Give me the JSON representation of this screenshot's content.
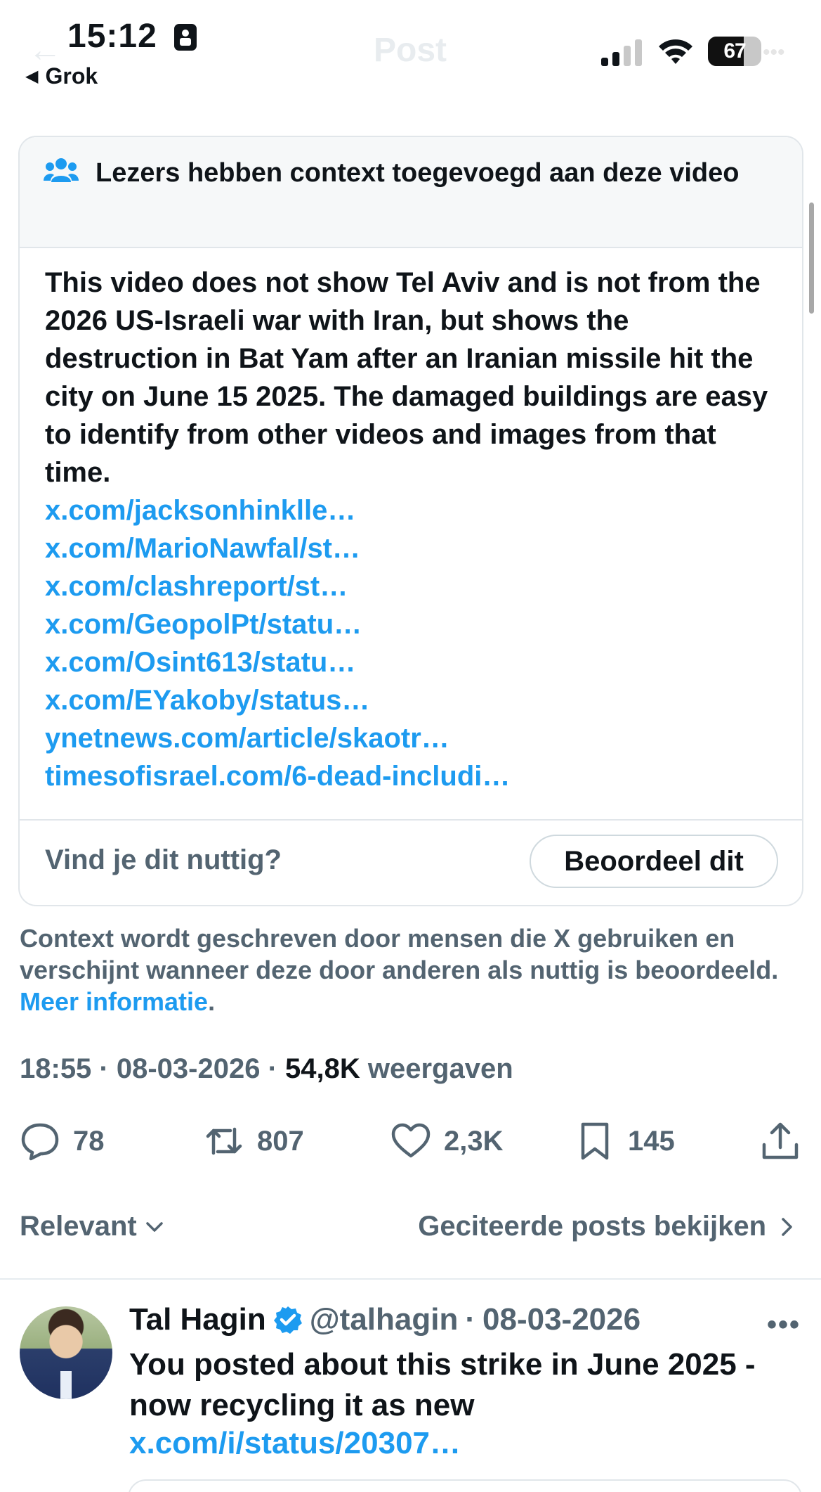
{
  "status_bar": {
    "time": "15:12",
    "back_app": "Grok",
    "battery": "67",
    "battery_level": 0.67
  },
  "header": {
    "title": "Post",
    "back_icon": "arrow-left-icon"
  },
  "note": {
    "title": "Lezers hebben context toegevoegd aan deze video",
    "body": "This video does not show Tel Aviv and is not from the 2026 US-Israeli war with Iran, but shows the destruction in Bat Yam after an Iranian missile hit the city on June 15 2025. The damaged buildings are easy to identify from other videos and images from that time.",
    "links": [
      "x.com/jacksonhinklle…",
      "x.com/MarioNawfal/st…",
      "x.com/clashreport/st…",
      "x.com/GeopolPt/statu…",
      "x.com/Osint613/statu…",
      "x.com/EYakoby/status…",
      "ynetnews.com/article/skaotr…",
      "timesofisrael.com/6-dead-includi…"
    ],
    "helpful_question": "Vind je dit nuttig?",
    "rate_button": "Beoordeel dit"
  },
  "context_info": {
    "text": "Context wordt geschreven door mensen die X gebruiken en verschijnt wanneer deze door anderen als nuttig is beoordeeld.",
    "link": "Meer informatie",
    "period": "."
  },
  "meta": {
    "time": "18:55",
    "sep1": " · ",
    "date": "08-03-2026",
    "sep2": " · ",
    "views": "54,8K",
    "views_label": " weergaven"
  },
  "actions": {
    "replies": "78",
    "reposts": "807",
    "likes": "2,3K",
    "bookmarks": "145"
  },
  "replies_section": {
    "sort_label": "Relevant",
    "quoted_label": "Geciteerde posts bekijken"
  },
  "reply": {
    "name": "Tal Hagin",
    "handle": "@talhagin",
    "sep": "·",
    "date": "08-03-2026",
    "text": "You posted about this strike in June 2025 - now recycling it as new",
    "link": "x.com/i/status/20307…"
  },
  "colors": {
    "accent": "#1d9bf0",
    "secondary_text": "#536471",
    "primary_text": "#0f1419"
  }
}
